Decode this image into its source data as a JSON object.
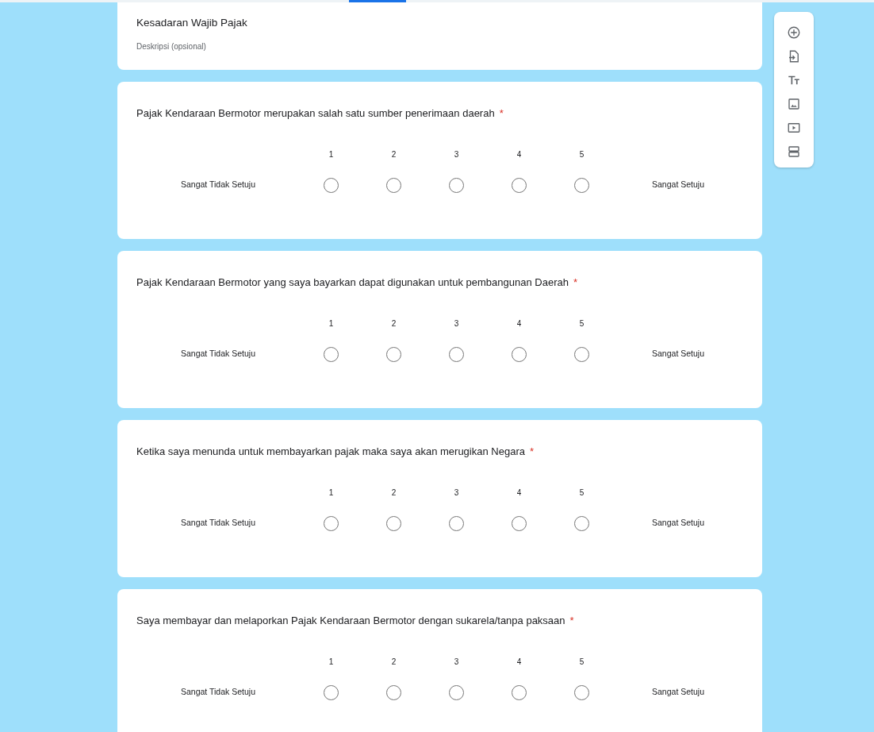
{
  "section": {
    "title": "Kesadaran Wajib Pajak",
    "description_placeholder": "Deskripsi (opsional)"
  },
  "questions": [
    {
      "text": "Pajak Kendaraan Bermotor merupakan salah satu sumber penerimaan daerah",
      "required_mark": "*",
      "low_label": "Sangat Tidak Setuju",
      "high_label": "Sangat Setuju",
      "options": [
        {
          "label": "1",
          "selected": false
        },
        {
          "label": "2",
          "selected": false
        },
        {
          "label": "3",
          "selected": false
        },
        {
          "label": "4",
          "selected": false
        },
        {
          "label": "5",
          "selected": false
        }
      ]
    },
    {
      "text": "Pajak Kendaraan Bermotor yang saya bayarkan dapat digunakan untuk pembangunan Daerah",
      "required_mark": "*",
      "low_label": "Sangat Tidak Setuju",
      "high_label": "Sangat Setuju",
      "options": [
        {
          "label": "1",
          "selected": false
        },
        {
          "label": "2",
          "selected": false
        },
        {
          "label": "3",
          "selected": false
        },
        {
          "label": "4",
          "selected": false
        },
        {
          "label": "5",
          "selected": false
        }
      ]
    },
    {
      "text": "Ketika saya menunda untuk membayarkan pajak maka saya akan merugikan Negara",
      "required_mark": "*",
      "low_label": "Sangat Tidak Setuju",
      "high_label": "Sangat Setuju",
      "options": [
        {
          "label": "1",
          "selected": false
        },
        {
          "label": "2",
          "selected": false
        },
        {
          "label": "3",
          "selected": false
        },
        {
          "label": "4",
          "selected": false
        },
        {
          "label": "5",
          "selected": false
        }
      ]
    },
    {
      "text": "Saya membayar dan melaporkan Pajak Kendaraan Bermotor dengan sukarela/tanpa paksaan",
      "required_mark": "*",
      "low_label": "Sangat Tidak Setuju",
      "high_label": "Sangat Setuju",
      "options": [
        {
          "label": "1",
          "selected": false
        },
        {
          "label": "2",
          "selected": false
        },
        {
          "label": "3",
          "selected": false
        },
        {
          "label": "4",
          "selected": false
        },
        {
          "label": "5",
          "selected": false
        }
      ]
    }
  ],
  "toolbar": [
    {
      "kind": "add"
    },
    {
      "kind": "import"
    },
    {
      "kind": "title"
    },
    {
      "kind": "image"
    },
    {
      "kind": "video"
    },
    {
      "kind": "section"
    }
  ]
}
